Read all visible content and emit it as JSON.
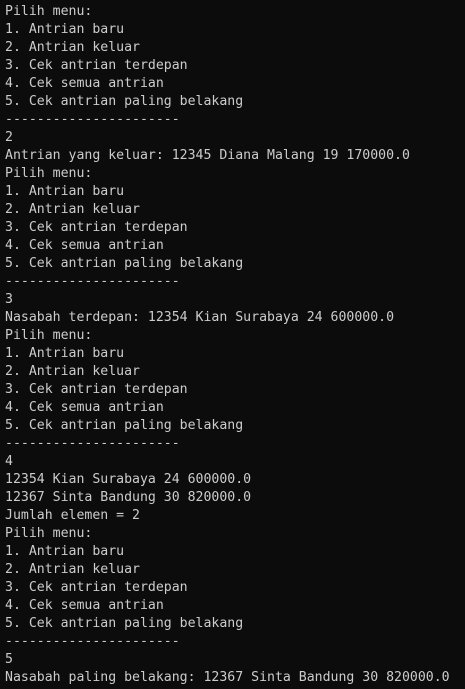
{
  "terminal": {
    "background": "#0c0c0c",
    "foreground": "#cccccc",
    "lines": [
      "Pilih menu:",
      "1. Antrian baru",
      "2. Antrian keluar",
      "3. Cek antrian terdepan",
      "4. Cek semua antrian",
      "5. Cek antrian paling belakang",
      "----------------------",
      "2",
      "Antrian yang keluar: 12345 Diana Malang 19 170000.0",
      "Pilih menu:",
      "1. Antrian baru",
      "2. Antrian keluar",
      "3. Cek antrian terdepan",
      "4. Cek semua antrian",
      "5. Cek antrian paling belakang",
      "----------------------",
      "3",
      "Nasabah terdepan: 12354 Kian Surabaya 24 600000.0",
      "Pilih menu:",
      "1. Antrian baru",
      "2. Antrian keluar",
      "3. Cek antrian terdepan",
      "4. Cek semua antrian",
      "5. Cek antrian paling belakang",
      "----------------------",
      "4",
      "12354 Kian Surabaya 24 600000.0",
      "12367 Sinta Bandung 30 820000.0",
      "Jumlah elemen = 2",
      "Pilih menu:",
      "1. Antrian baru",
      "2. Antrian keluar",
      "3. Cek antrian terdepan",
      "4. Cek semua antrian",
      "5. Cek antrian paling belakang",
      "----------------------",
      "5",
      "Nasabah paling belakang: 12367 Sinta Bandung 30 820000.0"
    ]
  }
}
